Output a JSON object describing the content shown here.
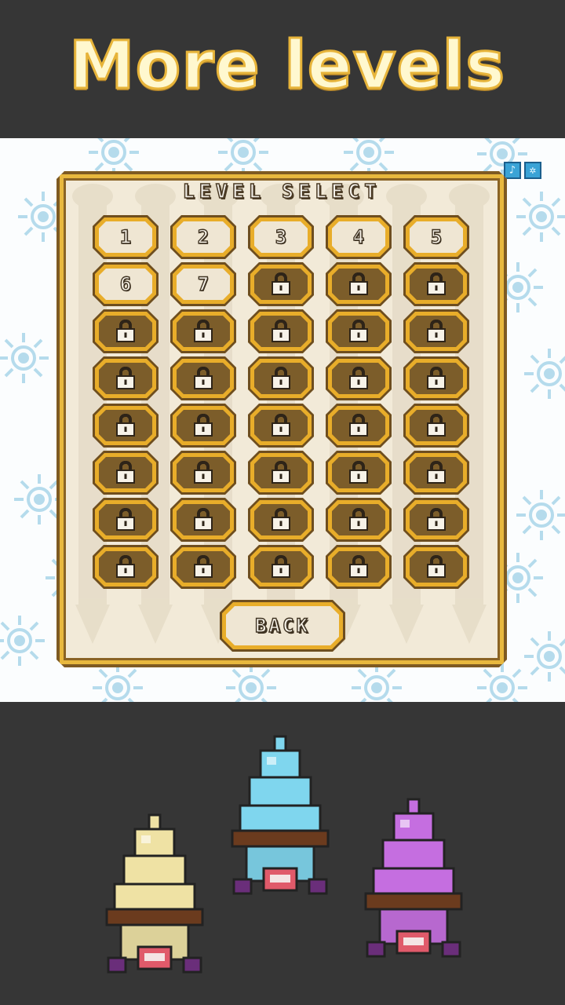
{
  "promo": {
    "title": "More levels"
  },
  "panel": {
    "title": "LEVEL SELECT"
  },
  "levels": [
    {
      "label": "1",
      "locked": false
    },
    {
      "label": "2",
      "locked": false
    },
    {
      "label": "3",
      "locked": false
    },
    {
      "label": "4",
      "locked": false
    },
    {
      "label": "5",
      "locked": false
    },
    {
      "label": "6",
      "locked": false
    },
    {
      "label": "7",
      "locked": false
    },
    {
      "label": "",
      "locked": true
    },
    {
      "label": "",
      "locked": true
    },
    {
      "label": "",
      "locked": true
    },
    {
      "label": "",
      "locked": true
    },
    {
      "label": "",
      "locked": true
    },
    {
      "label": "",
      "locked": true
    },
    {
      "label": "",
      "locked": true
    },
    {
      "label": "",
      "locked": true
    },
    {
      "label": "",
      "locked": true
    },
    {
      "label": "",
      "locked": true
    },
    {
      "label": "",
      "locked": true
    },
    {
      "label": "",
      "locked": true
    },
    {
      "label": "",
      "locked": true
    },
    {
      "label": "",
      "locked": true
    },
    {
      "label": "",
      "locked": true
    },
    {
      "label": "",
      "locked": true
    },
    {
      "label": "",
      "locked": true
    },
    {
      "label": "",
      "locked": true
    },
    {
      "label": "",
      "locked": true
    },
    {
      "label": "",
      "locked": true
    },
    {
      "label": "",
      "locked": true
    },
    {
      "label": "",
      "locked": true
    },
    {
      "label": "",
      "locked": true
    },
    {
      "label": "",
      "locked": true
    },
    {
      "label": "",
      "locked": true
    },
    {
      "label": "",
      "locked": true
    },
    {
      "label": "",
      "locked": true
    },
    {
      "label": "",
      "locked": true
    },
    {
      "label": "",
      "locked": true
    },
    {
      "label": "",
      "locked": true
    },
    {
      "label": "",
      "locked": true
    },
    {
      "label": "",
      "locked": true
    },
    {
      "label": "",
      "locked": true
    }
  ],
  "back_button": {
    "label": "BACK"
  },
  "icons": {
    "music": "music-note-icon",
    "sound": "sound-toggle-icon",
    "lock": "padlock-icon"
  },
  "characters": [
    {
      "name": "vanilla-ice-cream-kart",
      "color": "#efe2a4"
    },
    {
      "name": "mint-ice-cream-kart",
      "color": "#7fd6ee"
    },
    {
      "name": "grape-ice-cream-kart",
      "color": "#c56ee0"
    }
  ],
  "colors": {
    "background": "#363636",
    "title_fill": "#fff8cf",
    "title_outline": "#e7b43a",
    "panel": "#f2ead8",
    "button_gold": "#e8ad2a",
    "locked_face": "#7c5d2a",
    "snowflake": "#a9d6ea"
  }
}
